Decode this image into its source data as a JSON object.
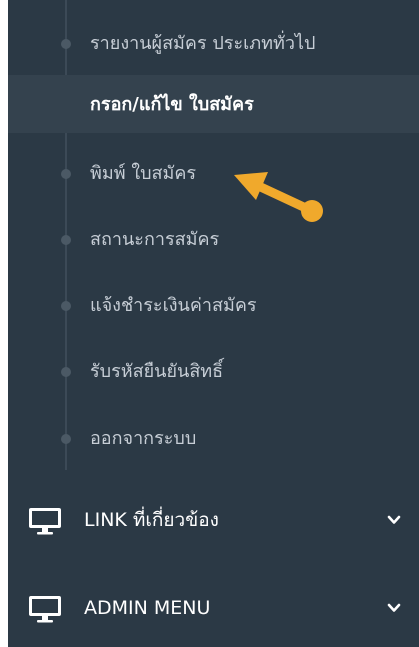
{
  "submenu": {
    "items": [
      {
        "label": "รายงานผู้สมัคร ประเภททั่วไป",
        "active": false
      },
      {
        "label": "กรอก/แก้ไข ใบสมัคร",
        "active": true
      },
      {
        "label": "พิมพ์ ใบสมัคร",
        "active": false
      },
      {
        "label": "สถานะการสมัคร",
        "active": false
      },
      {
        "label": "แจ้งชำระเงินค่าสมัคร",
        "active": false
      },
      {
        "label": "รับรหัสยืนยันสิทธิ์",
        "active": false
      },
      {
        "label": "ออกจากระบบ",
        "active": false
      }
    ]
  },
  "menu": {
    "link": {
      "label": "LINK ที่เกี่ยวข้อง",
      "icon": "monitor-icon"
    },
    "admin": {
      "label": "ADMIN MENU",
      "icon": "monitor-icon"
    }
  },
  "colors": {
    "sidebar_bg": "#2b3945",
    "active_bg": "#34424e",
    "pointer": "#f0a92c"
  }
}
